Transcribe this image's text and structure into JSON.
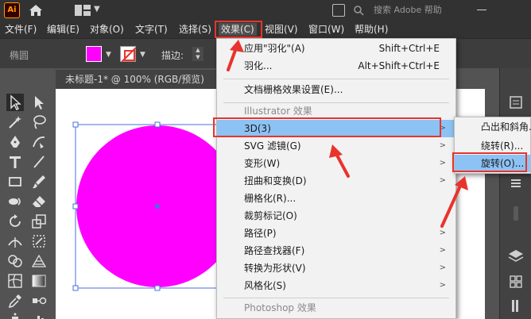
{
  "app": {
    "logo": "Ai",
    "search_text": "搜索 Adobe 帮助"
  },
  "menubar": {
    "items": [
      "文件(F)",
      "编辑(E)",
      "对象(O)",
      "文字(T)",
      "选择(S)",
      "效果(C)",
      "视图(V)",
      "窗口(W)",
      "帮助(H)"
    ],
    "active_index": 5
  },
  "control_bar": {
    "selection_label": "椭圆",
    "stroke_label": "描边:",
    "fill_color": "#ff00ff"
  },
  "document": {
    "tab_title": "未标题-1* @ 100% (RGB/预览)",
    "ellipse_fill": "#ff00ff",
    "selection_color": "#4a6ee0"
  },
  "effect_menu": {
    "items": [
      {
        "label": "应用\"羽化\"(A)",
        "shortcut": "Shift+Ctrl+E"
      },
      {
        "label": "羽化...",
        "shortcut": "Alt+Shift+Ctrl+E"
      },
      {
        "label": "文档栅格效果设置(E)..."
      },
      {
        "label": "Illustrator 效果",
        "header": true
      },
      {
        "label": "3D(3)",
        "submenu": true,
        "highlighted": true
      },
      {
        "label": "SVG 滤镜(G)",
        "submenu": true
      },
      {
        "label": "变形(W)",
        "submenu": true
      },
      {
        "label": "扭曲和变换(D)",
        "submenu": true
      },
      {
        "label": "栅格化(R)..."
      },
      {
        "label": "裁剪标记(O)"
      },
      {
        "label": "路径(P)",
        "submenu": true
      },
      {
        "label": "路径查找器(F)",
        "submenu": true
      },
      {
        "label": "转换为形状(V)",
        "submenu": true
      },
      {
        "label": "风格化(S)",
        "submenu": true
      },
      {
        "label": "Photoshop 效果",
        "header": true
      }
    ]
  },
  "submenu_3d": {
    "items": [
      {
        "label": "凸出和斜角..."
      },
      {
        "label": "绕转(R)..."
      },
      {
        "label": "旋转(O)...",
        "highlighted": true
      }
    ]
  },
  "annotation": {
    "highlight_color": "#e8342c",
    "hover_color": "#8dc2f5"
  }
}
